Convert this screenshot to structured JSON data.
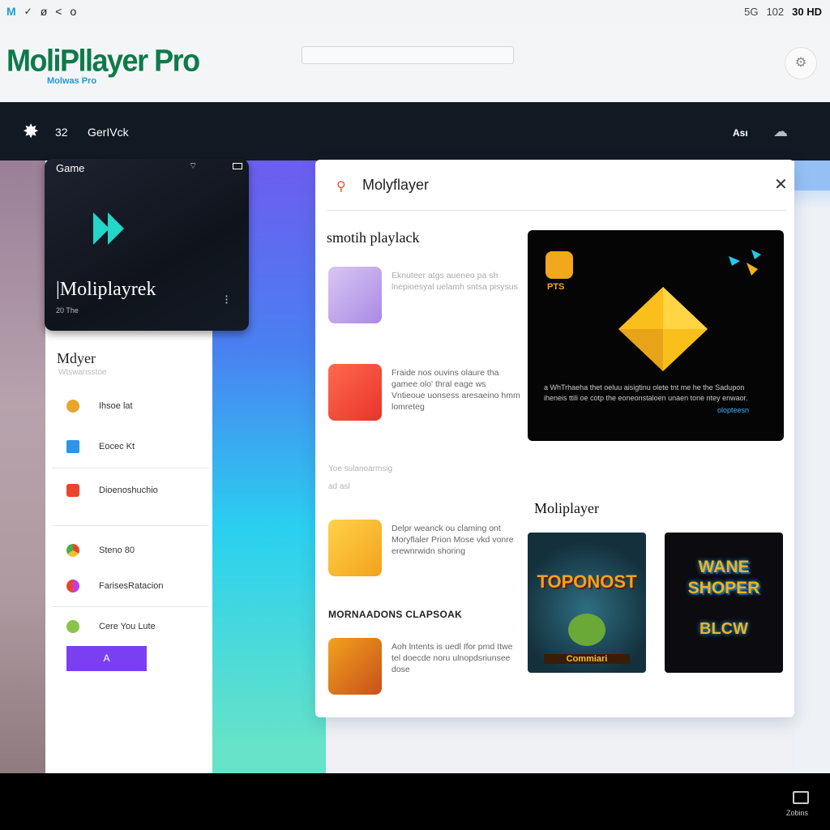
{
  "statusbar": {
    "left_icons": [
      "M",
      "✓",
      "ø",
      "<",
      "o"
    ],
    "right": [
      "5G",
      "102",
      "30 HD"
    ]
  },
  "header": {
    "logo": "MoliPllayer Pro",
    "logo_sub": "Molwas Pro",
    "settings_icon": "gear-icon"
  },
  "navbar": {
    "count": "32",
    "tab": "GerIVck",
    "right_label": "Ası"
  },
  "video_card": {
    "title": "Game",
    "name": "|Moliplayrek",
    "sub": "20 The",
    "play_icon": "play-icon"
  },
  "sidebar": {
    "section_title": "Mdyer",
    "section_sub": "Wtswansstoe",
    "items": [
      {
        "label": "Ihsoe lat",
        "color": "#e8a42c"
      },
      {
        "label": "Eocec Kt",
        "color": "#2f93e8"
      },
      {
        "label": "Dioenoshuchio",
        "color": "#e8462c"
      },
      {
        "label": "Steno 80",
        "color": "#3cb44b"
      },
      {
        "label": "FarisesRatacion",
        "color": "#c03ce8"
      },
      {
        "label": "Cere You Lute",
        "color": "#8bc34a"
      }
    ],
    "button_label": "A"
  },
  "main": {
    "title": "Molyflayer",
    "close_icon": "close-icon",
    "heading": "smotih playlack",
    "items": [
      {
        "text": "Eknuteer atgs aueneo pa sh lnepioesyal uelamh sntsa pisysus"
      },
      {
        "text": "Fraide nos ouvins olaure tha gamee olo' thral eage ws Vntieoue uonsess aresaeino hmm lomreteg"
      },
      {
        "text": "Delpr weanck ou claming ont Moryflaler Prion Mose vkd vonre erewnrwidn shoring"
      },
      {
        "text": "Aoh lntents is uedl Ifor pmd Itwe tel doecde noru ulnopdsriunsee dose"
      }
    ],
    "muted_line_1": "Yoe sulanoarmsig",
    "muted_line_2": "ad asl",
    "small_heading": "MORNAADONS CLAPSOAK",
    "card": {
      "tag": "PTS",
      "text": "a WhTrhaeha thet oeluu aisigtinu olete tnt me he the Sadupon iheneis ttili oe cotp the eoneonstaloen unaen tone ntey enwaor.",
      "link": "olopteesn"
    },
    "sub_heading": "Moliplayer",
    "game_tiles": [
      {
        "title": "TOPONOST",
        "sub": "Commiari"
      },
      {
        "title": "WANE SHOPER",
        "sub": "BLCW"
      }
    ]
  },
  "footer": {
    "label": "Zobins"
  }
}
